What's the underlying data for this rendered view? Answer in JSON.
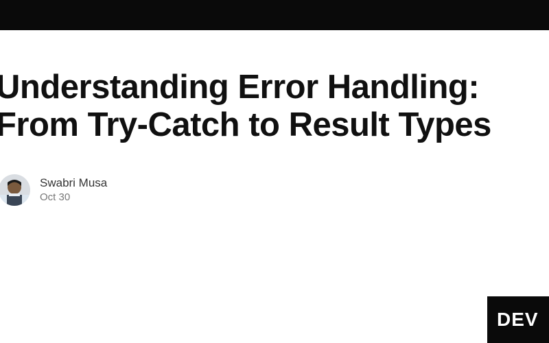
{
  "article": {
    "title": "Understanding Error Handling: From Try-Catch to Result Types",
    "author": "Swabri Musa",
    "date": "Oct 30"
  },
  "brand": {
    "badge_text": "DEV"
  }
}
